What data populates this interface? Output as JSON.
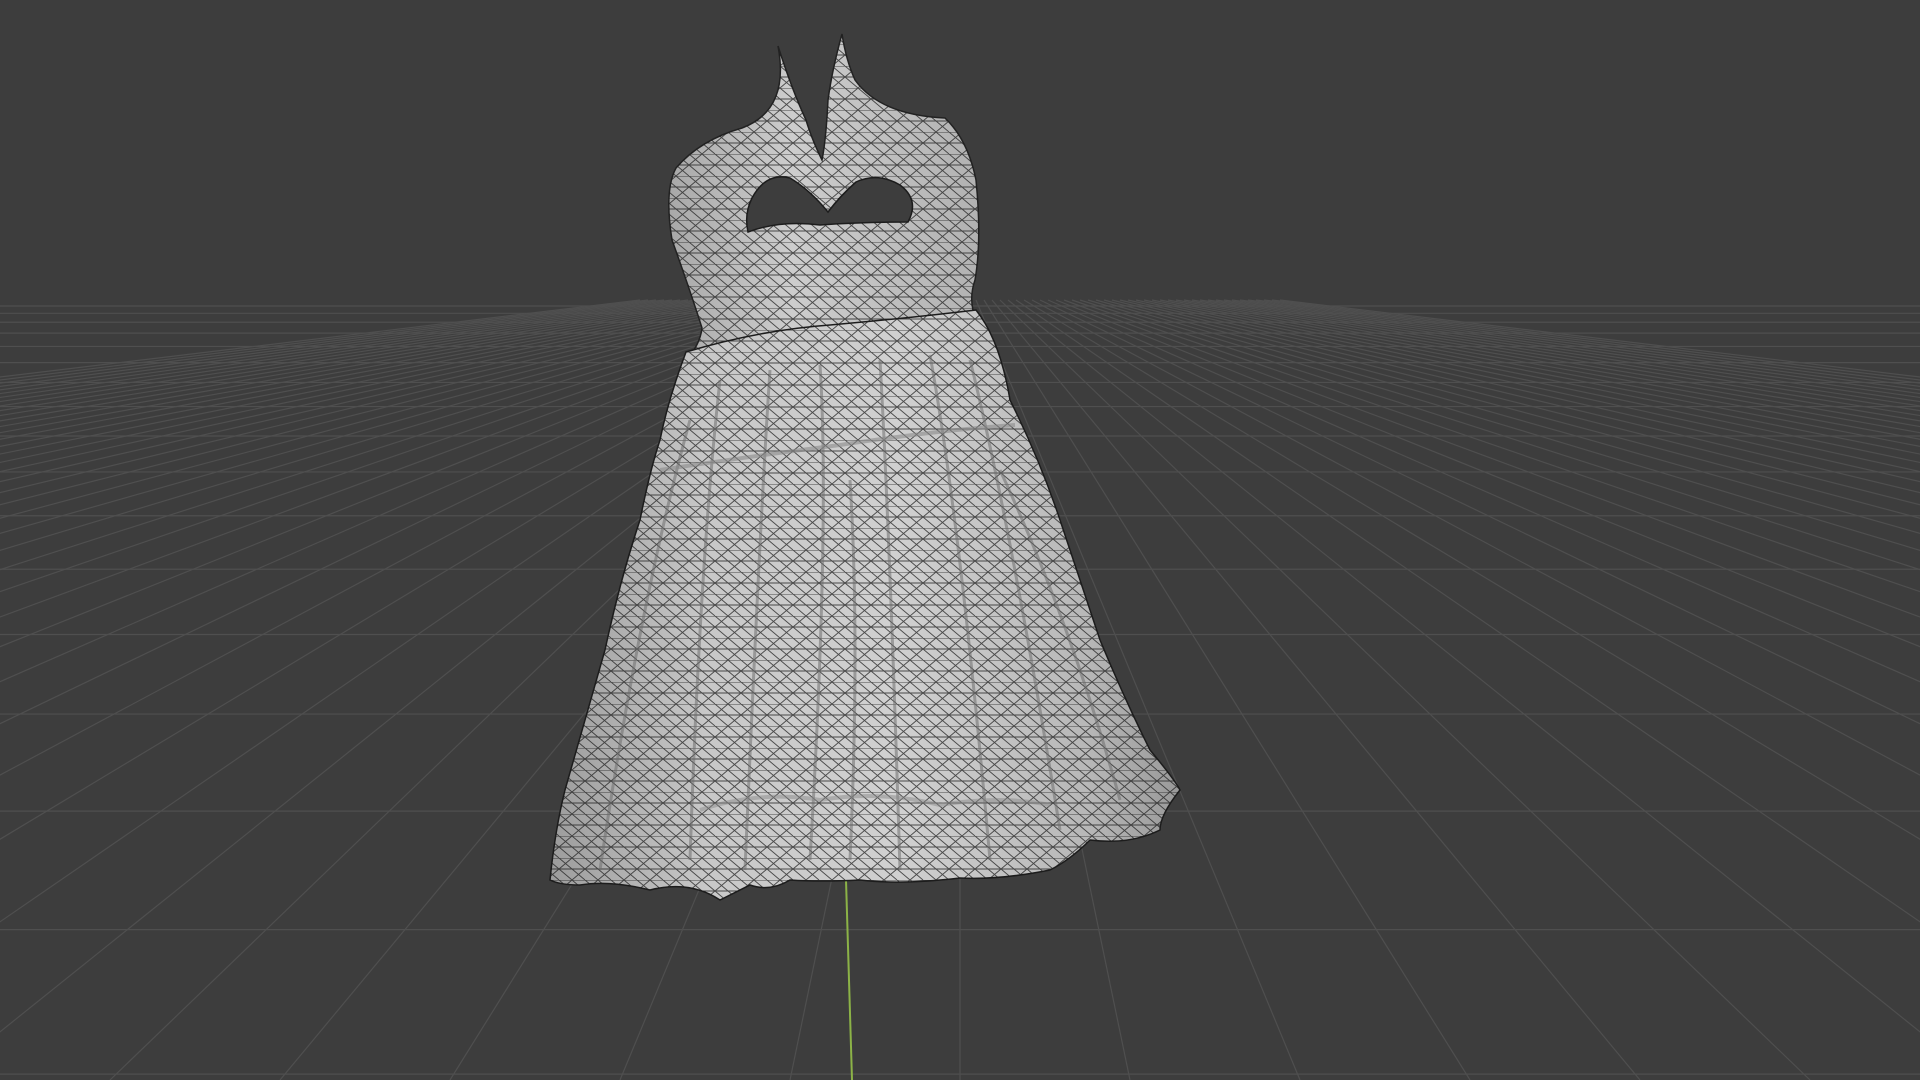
{
  "viewport": {
    "background_color": "#3d3d3d",
    "grid_line_color": "#4f4f4f",
    "y_axis_color": "#8cb347"
  },
  "mesh": {
    "object": "dress",
    "display": "solid-wireframe",
    "face_color": "#c4c4c4",
    "shadow_color": "#a2a2a2",
    "wire_color": "#1c1c1c"
  }
}
